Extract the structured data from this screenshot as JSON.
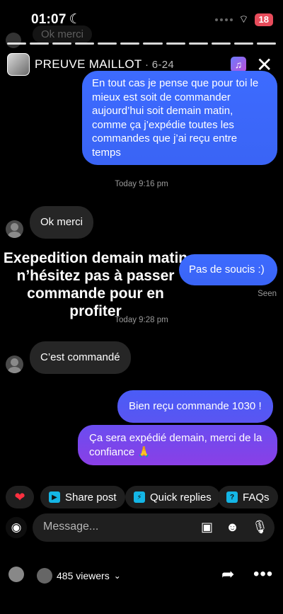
{
  "status": {
    "time": "01:07",
    "battery": "18"
  },
  "faded_message": "Ok merci",
  "header": {
    "name": "PREUVE MAILLOT",
    "time": " · 6-24"
  },
  "messages": {
    "m1": "En tout cas je pense que pour toi le mieux est soit de commander aujourd’hui soit demain matin, comme ça j’expédie toutes les commandes que j’ai reçu entre temps",
    "ts1": "Today 9:16 pm",
    "m2": "Ok merci",
    "m3": "Pas de soucis :)",
    "seen": "Seen",
    "ts2": "Today 9:28 pm",
    "m4": "C’est commandé",
    "m5": "Bien reçu commande 1030 !",
    "m6": "Ça sera expédié demain, merci de la confiance 🙏"
  },
  "overlay_text": "Exepedition demain matin n’hésitez pas à passer commande pour en profiter",
  "chips": {
    "share": "Share post",
    "quick": "Quick replies",
    "faqs": "FAQs"
  },
  "composer": {
    "placeholder": "Message..."
  },
  "footer": {
    "viewers": "485 viewers"
  },
  "colors": {
    "outgoing": "#3d6bff",
    "outgoing_end": "#8a3fe6",
    "incoming": "#262626",
    "battery": "#e84c5b"
  }
}
